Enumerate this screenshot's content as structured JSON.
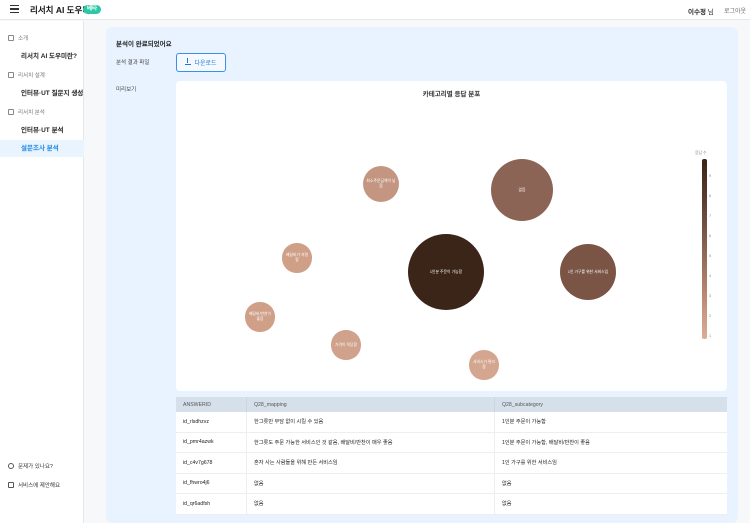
{
  "header": {
    "brand": "리서치 AI 도우미",
    "badge": "베타",
    "user_name": "이수정",
    "user_suffix": " 님",
    "logout": "로그아웃"
  },
  "sidebar": {
    "sections": [
      {
        "label": "소개",
        "icon": "home-icon",
        "items": [
          "리서치 AI 도우미란?"
        ]
      },
      {
        "label": "리서치 설계",
        "icon": "pencil-icon",
        "items": [
          "인터뷰·UT 질문지 생성"
        ]
      },
      {
        "label": "리서치 분석",
        "icon": "folder-icon",
        "items": [
          "인터뷰·UT 분석",
          "설문조사 분석"
        ]
      }
    ],
    "active_item": "설문조사 분석",
    "footer": [
      {
        "label": "문제가 있나요?",
        "icon": "help-icon"
      },
      {
        "label": "서비스에 제안해요",
        "icon": "megaphone-icon"
      }
    ]
  },
  "main": {
    "done_title": "분석이 완료되었어요",
    "file_label": "분석 결과 파일",
    "download_label": "다운로드",
    "preview_label": "미리보기"
  },
  "chart_data": {
    "type": "bubble",
    "title": "카테고리별 응답 분포",
    "colorbar_title": "응답 수",
    "colorbar_ticks": [
      "9",
      "8",
      "7",
      "6",
      "5",
      "4",
      "3",
      "2",
      "1"
    ],
    "bubbles": [
      {
        "label": "1인분 주문이 가능함",
        "value": 9
      },
      {
        "label": "없음",
        "value": 7
      },
      {
        "label": "1인 가구를 위한 서비스임",
        "value": 6
      },
      {
        "label": "최소주문금액이 낮음",
        "value": 3
      },
      {
        "label": "배달비가 저렴함",
        "value": 2
      },
      {
        "label": "배달비/반찬이 좋음",
        "value": 2
      },
      {
        "label": "가격이 적당함",
        "value": 2
      },
      {
        "label": "서비스가 편리함",
        "value": 2
      }
    ]
  },
  "table": {
    "columns": [
      "ANSWERID",
      "Q28_mapping",
      "Q28_subcategory"
    ],
    "rows": [
      [
        "id_rlsdhzvz",
        "한그릇만 부담 없이 시킬 수 있음",
        "1인분 주문이 가능함"
      ],
      [
        "id_pmr4azwk",
        "한그릇도 주문 가능한 서비스인 것 같음, 배달비/반찬이 매우 좋음",
        "1인분 주문이 가능함, 배달비/반찬이 좋음"
      ],
      [
        "id_c4v7g678",
        "혼자 사는 사람들을 위해 만든 서비스임",
        "1인 가구를 위한 서비스임"
      ],
      [
        "id_fhwro4j6",
        "없음",
        "없음"
      ],
      [
        "id_qr6adfsh",
        "없음",
        "없음"
      ]
    ]
  }
}
